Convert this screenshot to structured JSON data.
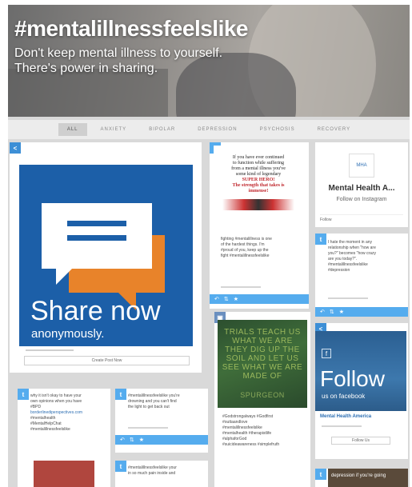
{
  "hero": {
    "hashtag": "#mentalillnessfeelslike",
    "line1": "Don't keep mental illness to yourself.",
    "line2": "There's power in sharing."
  },
  "filters": [
    {
      "label": "ALL",
      "active": true
    },
    {
      "label": "ANXIETY",
      "active": false
    },
    {
      "label": "BIPOLAR",
      "active": false
    },
    {
      "label": "DEPRESSION",
      "active": false
    },
    {
      "label": "PSYCHOSIS",
      "active": false
    },
    {
      "label": "RECOVERY",
      "active": false
    }
  ],
  "share_card": {
    "title": "Share now",
    "subtitle": "anonymously.",
    "button": "Create Post Now"
  },
  "superhero_card": {
    "quote_line1": "If you have ever continued",
    "quote_line2": "to function while suffering",
    "quote_line3": "from a mental illness you've",
    "quote_line4": "some kind of legendary",
    "quote_line5": "SUPER HERO!",
    "quote_line6": "The strength that takes is",
    "quote_line7": "immense!",
    "post_line1": "fighting #mentalillness is one",
    "post_line2": "of the hardest things. I'm",
    "post_line3": "#proud of you, keep up the",
    "post_line4": "fight #mentalillnessfeelslike"
  },
  "mha_card": {
    "logo": "MHA",
    "name": "Mental Health A...",
    "follow_text": "Follow on Instagram",
    "button": "Follow"
  },
  "tweet_card_right": {
    "line1": "I hate the moment in any",
    "line2": "relationship when \"how are",
    "line3": "you?\" becomes \"how crazy",
    "line4": "are you today?\".",
    "line5": "#mentalillnessfeelslike",
    "line6": "#depression"
  },
  "trials_card": {
    "line1": "TRIALS TEACH US",
    "line2": "WHAT WE ARE",
    "line3": "THEY DIG UP THE",
    "line4": "SOIL AND LET US",
    "line5": "SEE WHAT WE ARE",
    "line6": "MADE OF",
    "author": "SPURGEON",
    "tag1": "#Godstrongalways #Godfirst",
    "tag2": "#outtaandlove",
    "tag3": "#mentalillnessfeelslike",
    "tag4": "#mentalhealth #therapistlife",
    "tag5": "#alphaforGod",
    "tag6": "#suicideawareness #simplefruth"
  },
  "fb_card": {
    "icon": "f",
    "title": "Follow",
    "sub": "us on facebook",
    "name": "Mental Health America",
    "button": "Follow Us"
  },
  "tweet_bottom_left": {
    "line1": "why it isn't okay to have your",
    "line2": "own opinions when you have",
    "line3": "#BPD",
    "line4": "borderlinediperspectives.com",
    "line5": "#mentalhealth",
    "line6": "#MentalHelpChat",
    "line7": "#mentalillnessfeelslike"
  },
  "tweet_bottom_mid": {
    "line1": "#mentalillnessfeelslike you're",
    "line2": "drowning and you can't find",
    "line3": "the light to get back out"
  },
  "tweet_bottom_mid2": {
    "line1": "#mentalillnessfeelslike your",
    "line2": "in so much pain inside and"
  },
  "bottom_right_caption": "depression if you're going",
  "colors": {
    "twitter": "#55acee",
    "share_blue": "#1c5fa8",
    "orange": "#e8832a",
    "mha_link": "#2d6fb3"
  }
}
